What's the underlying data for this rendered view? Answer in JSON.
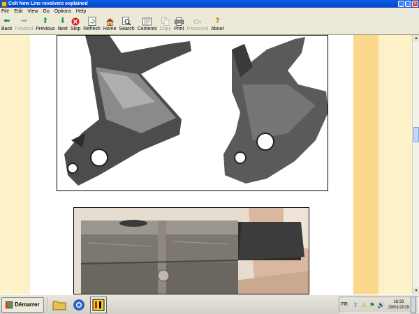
{
  "window": {
    "title": "Colt New Line revolvers explained"
  },
  "menu": {
    "items": [
      "File",
      "Edit",
      "View",
      "Go",
      "Options",
      "Help"
    ]
  },
  "toolbar": {
    "buttons": [
      {
        "label": "Back",
        "icon": "back-arrow-icon",
        "enabled": true
      },
      {
        "label": "Forward",
        "icon": "forward-arrow-icon",
        "enabled": false
      },
      {
        "label": "Previous",
        "icon": "up-arrow-icon",
        "enabled": true
      },
      {
        "label": "Next",
        "icon": "down-arrow-icon",
        "enabled": true
      },
      {
        "label": "Stop",
        "icon": "stop-icon",
        "enabled": true
      },
      {
        "label": "Refresh",
        "icon": "refresh-icon",
        "enabled": true
      },
      {
        "label": "Home",
        "icon": "home-icon",
        "enabled": true
      },
      {
        "label": "Search",
        "icon": "search-icon",
        "enabled": true
      },
      {
        "label": "Contents",
        "icon": "contents-icon",
        "enabled": true
      },
      {
        "label": "Copy",
        "icon": "copy-icon",
        "enabled": false
      },
      {
        "label": "Print",
        "icon": "print-icon",
        "enabled": true
      },
      {
        "label": "Password",
        "icon": "password-icon",
        "enabled": false
      },
      {
        "label": "About",
        "icon": "about-icon",
        "enabled": true
      }
    ]
  },
  "taskbar": {
    "start_label": "Démarrer",
    "language": "FR",
    "time": "16:33",
    "date": "29/01/2019"
  },
  "colors": {
    "titlebar": "#0a5ee8",
    "page_background": "#fdf1c8",
    "stripe": "#fbd88c"
  }
}
